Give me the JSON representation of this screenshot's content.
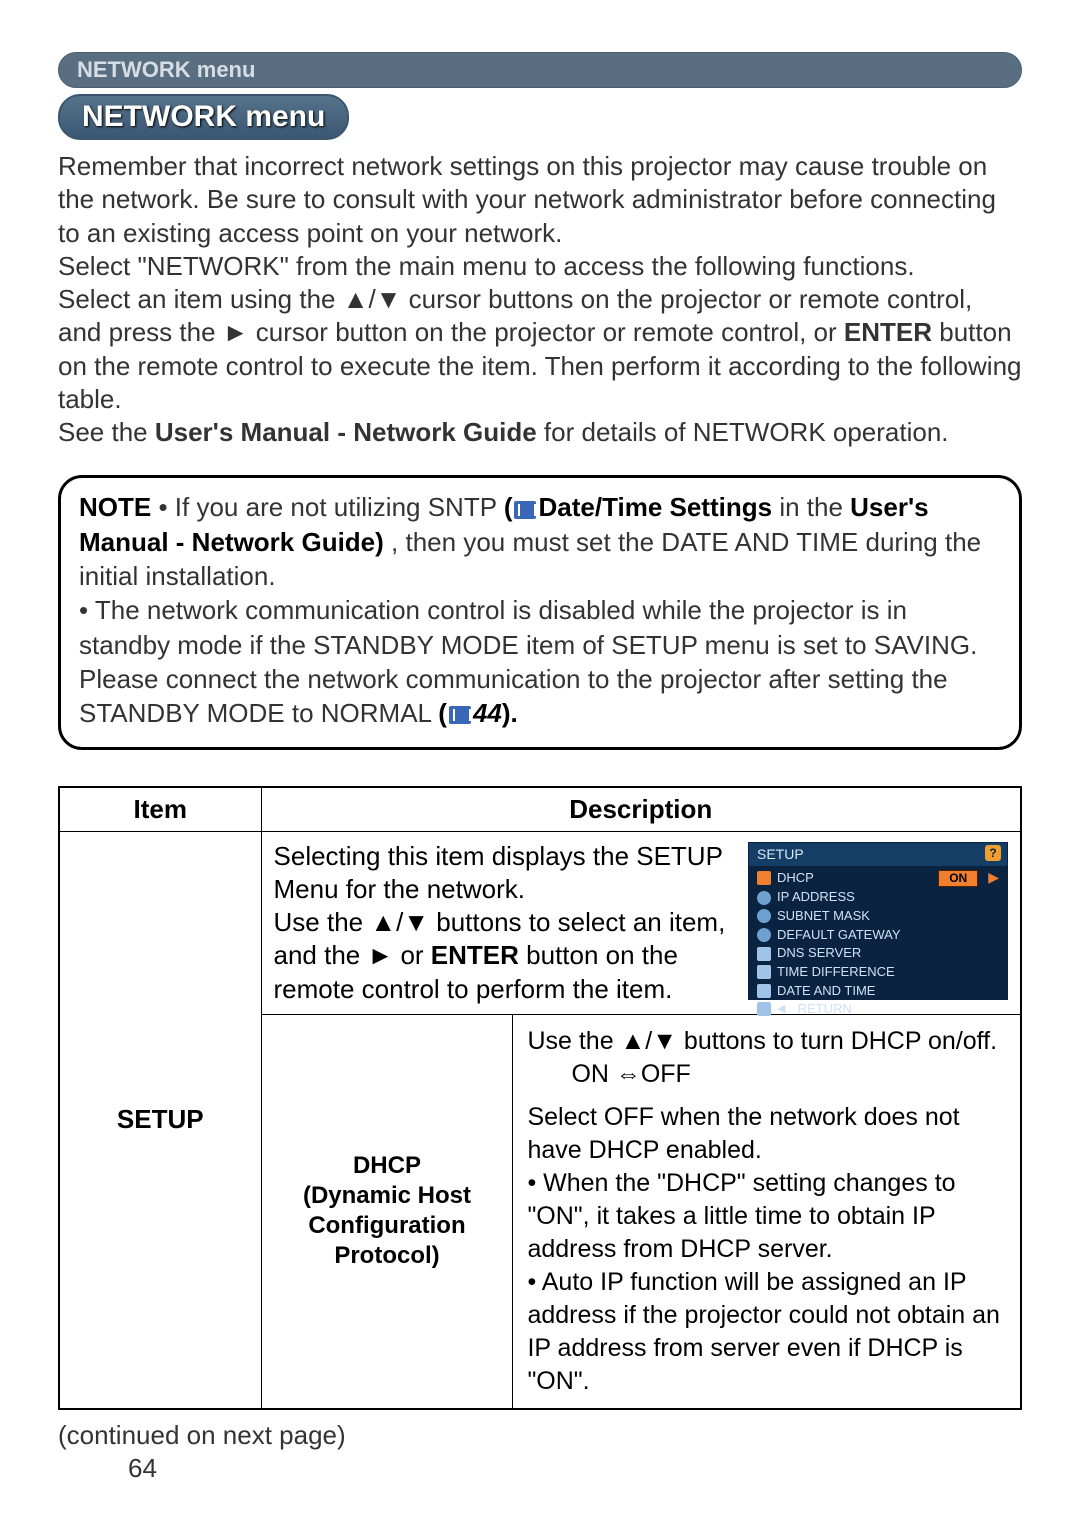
{
  "section_bar": "NETWORK menu",
  "section_pill": "NETWORK menu",
  "intro": {
    "p1": "Remember that incorrect network settings on this projector may cause trouble on the network. Be sure to consult with your network administrator before connecting to an existing access point on your network.",
    "p2a": "Select \"NETWORK\" from the main menu to access the following functions.",
    "p3a": "Select an item using the ▲/▼ cursor buttons on the projector or remote control, and press the ► cursor button on the projector or remote control, or ",
    "p3_enter": "ENTER",
    "p3b": " button on the remote control to execute the item. Then perform it according to the following table.",
    "p4a": "See the ",
    "p4_manual": "User's Manual - Network Guide",
    "p4b": " for details of NETWORK operation."
  },
  "note": {
    "label": "NOTE",
    "line1a": "  • If you are not utilizing SNTP ",
    "line1b": "(",
    "line1_link": "Date/Time Settings",
    "line1c": " in the ",
    "line1_manual": "User's Manual - Network Guide)",
    "line1d": ", then you must set the DATE AND TIME during the initial installation.",
    "line2a": "• The network communication control is disabled while the projector is in standby mode if the STANDBY MODE item of SETUP menu is set to SAVING. Please connect the network communication to the projector after setting the STANDBY MODE to NORMAL ",
    "line2_ref": "(",
    "line2_refnum": "44",
    "line2_refend": ")."
  },
  "table": {
    "head_item": "Item",
    "head_desc": "Description",
    "setup_label": "SETUP",
    "setup_desc_a": "Selecting this item displays the SETUP Menu for the network.",
    "setup_desc_b": "Use the ▲/▼ buttons to select an item, and the ► or ",
    "setup_desc_enter": "ENTER",
    "setup_desc_c": " button on the remote control to perform the item.",
    "dhcp_name_a": "DHCP",
    "dhcp_name_b": "(Dynamic Host Conﬁguration Protocol)",
    "dhcp_desc_a": "Use the ▲/▼ buttons to turn DHCP on/off.",
    "dhcp_on": "ON",
    "dhcp_sep": "⇔",
    "dhcp_off": "OFF",
    "dhcp_desc_b": "Select OFF when the network does not have DHCP enabled.",
    "dhcp_desc_c": "• When the \"DHCP\" setting changes to \"ON\", it takes a little time to obtain IP address from DHCP server.",
    "dhcp_desc_d": "• Auto IP function will be assigned an IP address if the projector could not obtain an IP address from server even if DHCP is \"ON\"."
  },
  "osd": {
    "title": "SETUP",
    "rows": [
      {
        "label": "DHCP",
        "on": "ON"
      },
      {
        "label": "IP ADDRESS"
      },
      {
        "label": "SUBNET MASK"
      },
      {
        "label": "DEFAULT GATEWAY"
      },
      {
        "label": "DNS SERVER"
      },
      {
        "label": "TIME DIFFERENCE"
      },
      {
        "label": "DATE AND TIME"
      },
      {
        "label": "RETURN",
        "ret": true
      }
    ]
  },
  "continued": "(continued on next page)",
  "page_num": "64"
}
